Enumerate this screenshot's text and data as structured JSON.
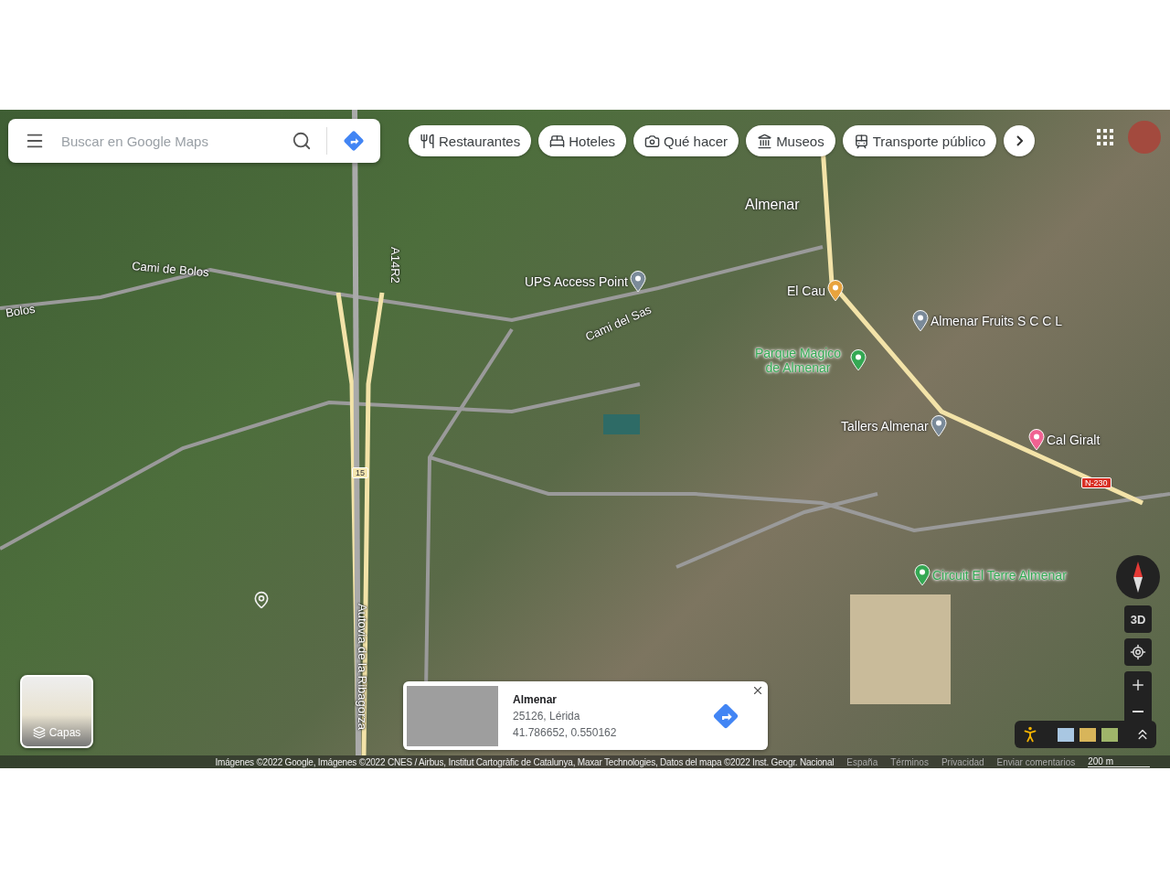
{
  "search": {
    "placeholder": "Buscar en Google Maps"
  },
  "chips": [
    {
      "kind": "restaurant",
      "label": "Restaurantes"
    },
    {
      "kind": "hotel",
      "label": "Hoteles"
    },
    {
      "kind": "todo",
      "label": "Qué hacer"
    },
    {
      "kind": "museum",
      "label": "Museos"
    },
    {
      "kind": "transit",
      "label": "Transporte público"
    }
  ],
  "map_labels": [
    {
      "kind": "road",
      "text": "Cami de Bolos"
    },
    {
      "kind": "road",
      "text": "Bolos"
    },
    {
      "kind": "road",
      "text": "A14R2"
    },
    {
      "kind": "poi",
      "text": "UPS Access Point",
      "color": "#7a8a99"
    },
    {
      "kind": "road",
      "text": "Cami del Sas"
    },
    {
      "kind": "town",
      "text": "Almenar"
    },
    {
      "kind": "poi",
      "text": "El Cau",
      "color": "#e8a33d"
    },
    {
      "kind": "poi",
      "text": "Almenar Fruits S C C L",
      "color": "#7a8a99"
    },
    {
      "kind": "park",
      "text": "Parque Magico de Almenar",
      "color": "#34a853"
    },
    {
      "kind": "poi",
      "text": "Tallers Almenar",
      "color": "#7a8a99"
    },
    {
      "kind": "poi",
      "text": "Cal Giralt",
      "color": "#f06292"
    },
    {
      "kind": "shield",
      "text": "N-230",
      "color": "#d93025"
    },
    {
      "kind": "shield",
      "text": "15",
      "color": "#f5e6b0"
    },
    {
      "kind": "park",
      "text": "Circuit El Terre Almenar",
      "color": "#34a853"
    },
    {
      "kind": "road",
      "text": "Autovia de la Ribagorza"
    }
  ],
  "layers": {
    "label": "Capas"
  },
  "place_card": {
    "title": "Almenar",
    "address": "25126, Lérida",
    "coordinates": "41.786652, 0.550162"
  },
  "view_3d": "3D",
  "attribution": "Imágenes ©2022 Google, Imágenes ©2022 CNES / Airbus, Institut Cartogràfic de Catalunya, Maxar Technologies, Datos del mapa ©2022 Inst. Geogr. Nacional",
  "footer_links": [
    "España",
    "Términos",
    "Privacidad",
    "Enviar comentarios"
  ],
  "scale": "200 m"
}
